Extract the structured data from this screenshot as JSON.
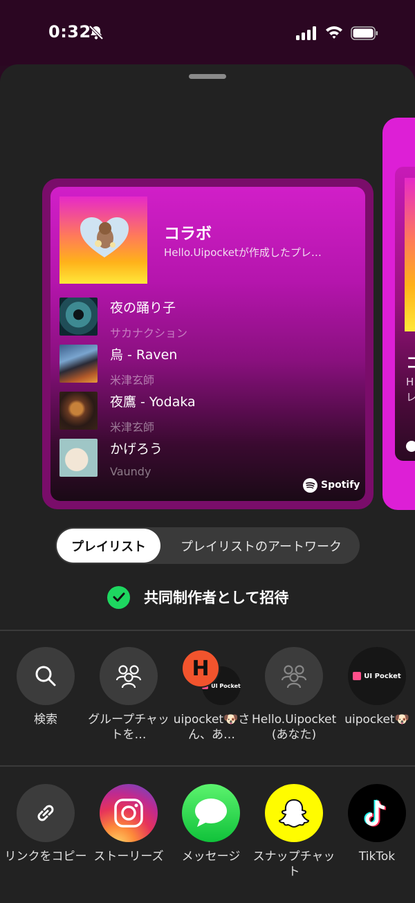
{
  "status_bar": {
    "time": "0:32"
  },
  "playlist_card": {
    "title": "コラボ",
    "subtitle": "Hello.Uipocketが作成したプレ…",
    "tracks": [
      {
        "title": "夜の踊り子",
        "artist": "サカナクション"
      },
      {
        "title": "烏 - Raven",
        "artist": "米津玄師"
      },
      {
        "title": "夜鷹 - Yodaka",
        "artist": "米津玄師"
      },
      {
        "title": "かげろう",
        "artist": "Vaundy"
      }
    ],
    "brand": "Spotify"
  },
  "peek_card": {
    "title_fragment": "コ",
    "line1": "H",
    "line2": "レ"
  },
  "segment": {
    "active": "プレイリスト",
    "inactive": "プレイリストのアートワーク"
  },
  "invite": {
    "label": "共同制作者として招待"
  },
  "contacts": [
    {
      "label": "検索",
      "icon": "search-icon"
    },
    {
      "label": "グループチャットを…",
      "icon": "group-icon"
    },
    {
      "label": "uipocket🐶さん、あ…",
      "icon": "avatar-h",
      "avatar_letter": "H",
      "badge": "UI Pocket"
    },
    {
      "label": "Hello.Uipocket (あなた)",
      "icon": "group-icon"
    },
    {
      "label": "uipocket🐶",
      "icon": "avatar-uipocket",
      "badge": "UI Pocket"
    }
  ],
  "apps": [
    {
      "label": "リンクをコピー",
      "icon": "link-icon"
    },
    {
      "label": "ストーリーズ",
      "icon": "instagram-icon"
    },
    {
      "label": "メッセージ",
      "icon": "messages-icon"
    },
    {
      "label": "スナップチャット",
      "icon": "snapchat-icon"
    },
    {
      "label": "TikTok",
      "icon": "tiktok-icon"
    }
  ],
  "colors": {
    "accent_green": "#1ed760",
    "card_magenta": "#d11fc8",
    "sheet_bg": "#222222"
  }
}
